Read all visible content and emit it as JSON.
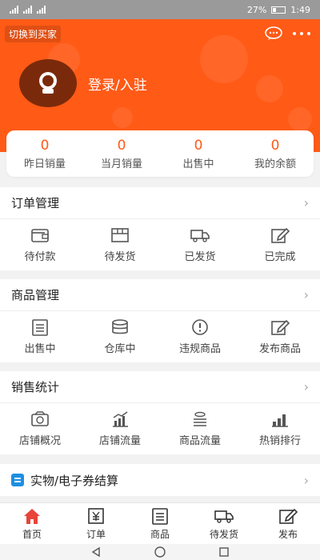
{
  "status_bar": {
    "battery": "27%",
    "time": "1:49"
  },
  "header": {
    "switch_buyer": "切换到买家",
    "login": "登录/入驻"
  },
  "stats": [
    {
      "value": "0",
      "label": "昨日销量"
    },
    {
      "value": "0",
      "label": "当月销量"
    },
    {
      "value": "0",
      "label": "出售中"
    },
    {
      "value": "0",
      "label": "我的余额"
    }
  ],
  "orders": {
    "title": "订单管理",
    "items": [
      {
        "label": "待付款",
        "icon": "wallet-icon"
      },
      {
        "label": "待发货",
        "icon": "box-icon"
      },
      {
        "label": "已发货",
        "icon": "truck-icon"
      },
      {
        "label": "已完成",
        "icon": "edit-icon"
      }
    ]
  },
  "products": {
    "title": "商品管理",
    "items": [
      {
        "label": "出售中",
        "icon": "list-icon"
      },
      {
        "label": "仓库中",
        "icon": "database-icon"
      },
      {
        "label": "违规商品",
        "icon": "alert-icon"
      },
      {
        "label": "发布商品",
        "icon": "edit-icon"
      }
    ]
  },
  "sales": {
    "title": "销售统计",
    "items": [
      {
        "label": "店铺概况",
        "icon": "money-icon"
      },
      {
        "label": "店铺流量",
        "icon": "chart-icon"
      },
      {
        "label": "商品流量",
        "icon": "coins-icon"
      },
      {
        "label": "热销排行",
        "icon": "bars-icon"
      }
    ]
  },
  "settlement": {
    "title": "实物/电子券结算"
  },
  "tabbar": [
    {
      "label": "首页",
      "icon": "home-icon"
    },
    {
      "label": "订单",
      "icon": "yen-icon"
    },
    {
      "label": "商品",
      "icon": "list-icon"
    },
    {
      "label": "待发货",
      "icon": "truck-icon"
    },
    {
      "label": "发布",
      "icon": "edit-icon"
    }
  ],
  "colors": {
    "accent": "#ff5a16",
    "home_active": "#e8443a",
    "settle_icon": "#1e8fe1"
  }
}
